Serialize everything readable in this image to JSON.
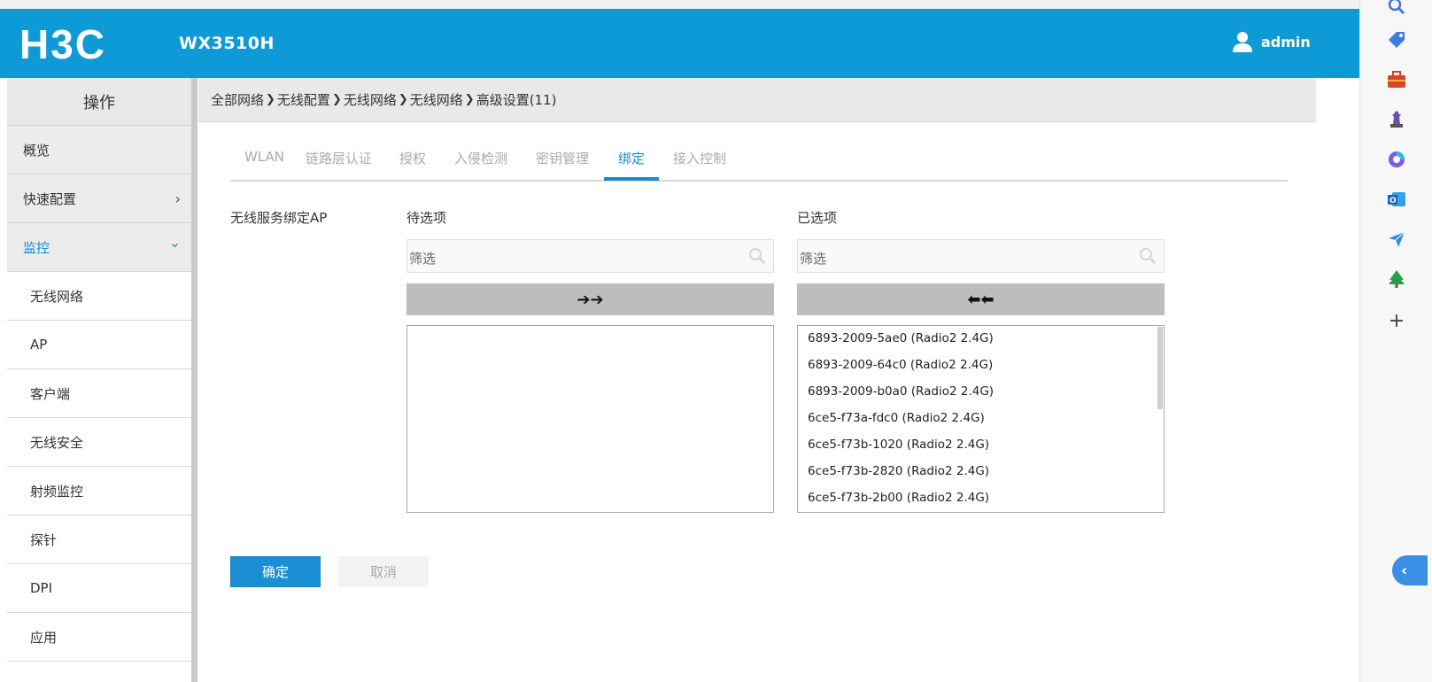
{
  "header": {
    "brand": "H3C",
    "model": "WX3510H",
    "user": "admin"
  },
  "sidebar": {
    "title": "操作",
    "items": [
      {
        "label": "概览",
        "type": "group"
      },
      {
        "label": "快速配置",
        "type": "group",
        "chevron": "›"
      },
      {
        "label": "监控",
        "type": "group",
        "chevron": "⌄",
        "active": true
      },
      {
        "label": "无线网络",
        "type": "sub"
      },
      {
        "label": "AP",
        "type": "sub"
      },
      {
        "label": "客户端",
        "type": "sub"
      },
      {
        "label": "无线安全",
        "type": "sub"
      },
      {
        "label": "射频监控",
        "type": "sub"
      },
      {
        "label": "探针",
        "type": "sub"
      },
      {
        "label": "DPI",
        "type": "sub"
      },
      {
        "label": "应用",
        "type": "sub"
      }
    ]
  },
  "breadcrumb": [
    "全部网络",
    "无线配置",
    "无线网络",
    "无线网络",
    "高级设置(11)"
  ],
  "tabs": [
    {
      "label": "WLAN"
    },
    {
      "label": "链路层认证"
    },
    {
      "label": "授权"
    },
    {
      "label": "入侵检测"
    },
    {
      "label": "密钥管理"
    },
    {
      "label": "绑定",
      "active": true
    },
    {
      "label": "接入控制"
    }
  ],
  "binding": {
    "field_label": "无线服务绑定AP",
    "available": {
      "title": "待选项",
      "filter_placeholder": "筛选",
      "move_button": "➔➔",
      "items": []
    },
    "selected": {
      "title": "已选项",
      "filter_placeholder": "筛选",
      "move_button": "⬅⬅",
      "items": [
        "6893-2009-5ae0 (Radio2 2.4G)",
        "6893-2009-64c0 (Radio2 2.4G)",
        "6893-2009-b0a0 (Radio2 2.4G)",
        "6ce5-f73a-fdc0 (Radio2 2.4G)",
        "6ce5-f73b-1020 (Radio2 2.4G)",
        "6ce5-f73b-2820 (Radio2 2.4G)",
        "6ce5-f73b-2b00 (Radio2 2.4G)"
      ]
    }
  },
  "actions": {
    "ok": "确定",
    "cancel": "取消"
  },
  "rail_icons": [
    "search-icon",
    "tag-icon",
    "toolbox-icon",
    "chess-icon",
    "copilot-icon",
    "outlook-icon",
    "send-icon",
    "tree-icon",
    "plus-icon"
  ],
  "rail_plus": "+",
  "rail_collapse": "‹",
  "colors": {
    "header": "#0d9ad7",
    "accent": "#1a8ad0"
  }
}
